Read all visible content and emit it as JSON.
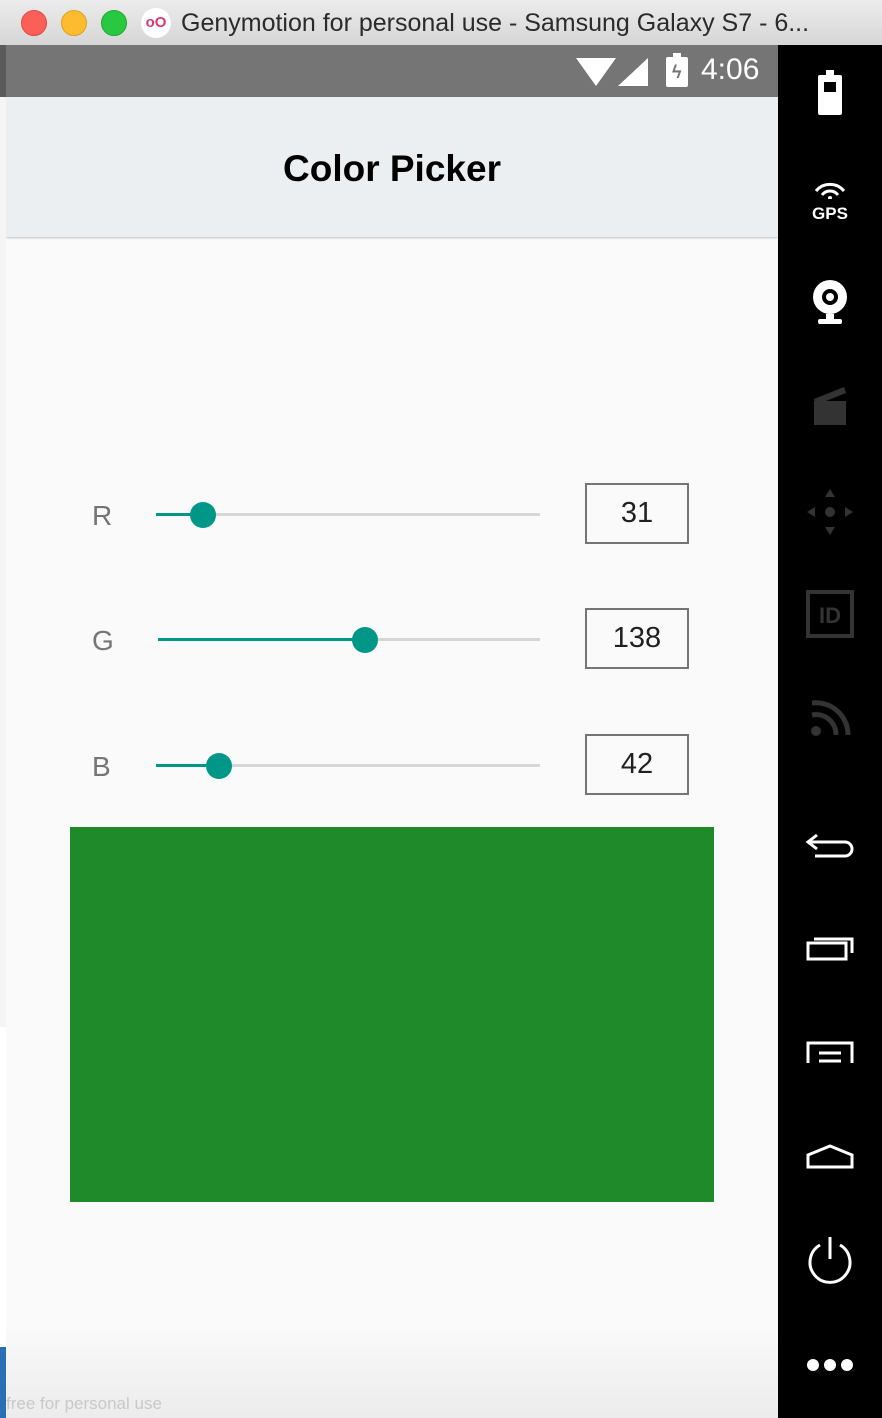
{
  "window": {
    "title": "Genymotion for personal use - Samsung Galaxy S7 - 6...",
    "app_icon_text": "oO"
  },
  "status_bar": {
    "time": "4:06"
  },
  "app": {
    "title": "Color Picker"
  },
  "channels": [
    {
      "label": "R",
      "value": "31",
      "level": 31,
      "max": 255
    },
    {
      "label": "G",
      "value": "138",
      "level": 138,
      "max": 255
    },
    {
      "label": "B",
      "value": "42",
      "level": 42,
      "max": 255
    }
  ],
  "preview": {
    "color": "#1f8a2a"
  },
  "colors": {
    "accent": "#009688",
    "track": "#d6d6d6",
    "status_bar": "#757575",
    "app_bar": "#eceff2"
  },
  "sidebar": {
    "gps_label": "GPS",
    "id_label": "ID",
    "icons": [
      "battery-icon",
      "gps-icon",
      "webcam-icon",
      "clapperboard-icon",
      "dpad-icon",
      "id-icon",
      "cast-icon",
      "back-icon",
      "recent-apps-icon",
      "menu-icon",
      "home-icon",
      "power-icon",
      "more-icon"
    ]
  },
  "watermark": "free for personal use"
}
